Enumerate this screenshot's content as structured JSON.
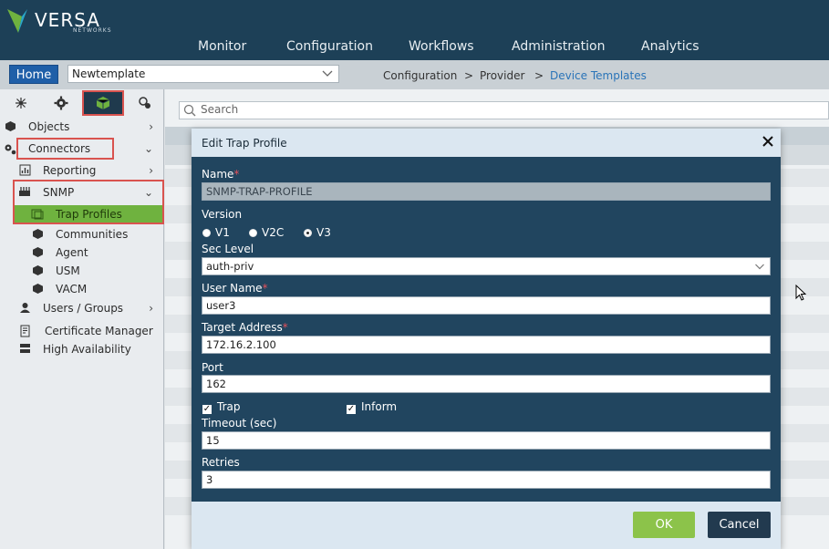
{
  "app": {
    "logo": {
      "name": "VERSA",
      "sub": "NETWORKS"
    },
    "nav": [
      "Monitor",
      "Configuration",
      "Workflows",
      "Administration",
      "Analytics"
    ]
  },
  "toolbar": {
    "home_label": "Home",
    "template_value": "Newtemplate",
    "breadcrumb": [
      "Configuration",
      ">",
      "Provider",
      ">",
      "Device Templates"
    ]
  },
  "sidebar": {
    "items": [
      {
        "label": "Objects",
        "icon": "cube-icon"
      },
      {
        "label": "Connectors",
        "icon": "gears-icon"
      },
      {
        "label": "Reporting",
        "icon": "report-icon"
      },
      {
        "label": "SNMP",
        "icon": "snmp-icon"
      },
      {
        "label": "Trap Profiles",
        "icon": "trap-icon"
      },
      {
        "label": "Communities",
        "icon": "cube-icon"
      },
      {
        "label": "Agent",
        "icon": "cube-icon"
      },
      {
        "label": "USM",
        "icon": "cube-icon"
      },
      {
        "label": "VACM",
        "icon": "cube-icon"
      },
      {
        "label": "Users / Groups",
        "icon": "user-icon"
      },
      {
        "label": "Certificate Manager",
        "icon": "certificate-icon"
      },
      {
        "label": "High Availability",
        "icon": "ha-icon"
      }
    ]
  },
  "content": {
    "search_placeholder": "Search"
  },
  "modal": {
    "title": "Edit Trap Profile",
    "name_label": "Name",
    "name_value": "SNMP-TRAP-PROFILE",
    "version_label": "Version",
    "versions": [
      "V1",
      "V2C",
      "V3"
    ],
    "version_selected": "V3",
    "sec_level_label": "Sec Level",
    "sec_level_value": "auth-priv",
    "user_name_label": "User Name",
    "user_name_value": "user3",
    "target_address_label": "Target Address",
    "target_address_value": "172.16.2.100",
    "port_label": "Port",
    "port_value": "162",
    "trap_label": "Trap",
    "inform_label": "Inform",
    "timeout_label": "Timeout (sec)",
    "timeout_value": "15",
    "retries_label": "Retries",
    "retries_value": "3",
    "ok_label": "OK",
    "cancel_label": "Cancel",
    "required_mark": "*"
  },
  "colors": {
    "nav_bg": "#1d4057",
    "modal_bg": "#21455f",
    "accent_green": "#6fb23f",
    "highlight_red": "#d9534f",
    "link_blue": "#2a74b8"
  }
}
